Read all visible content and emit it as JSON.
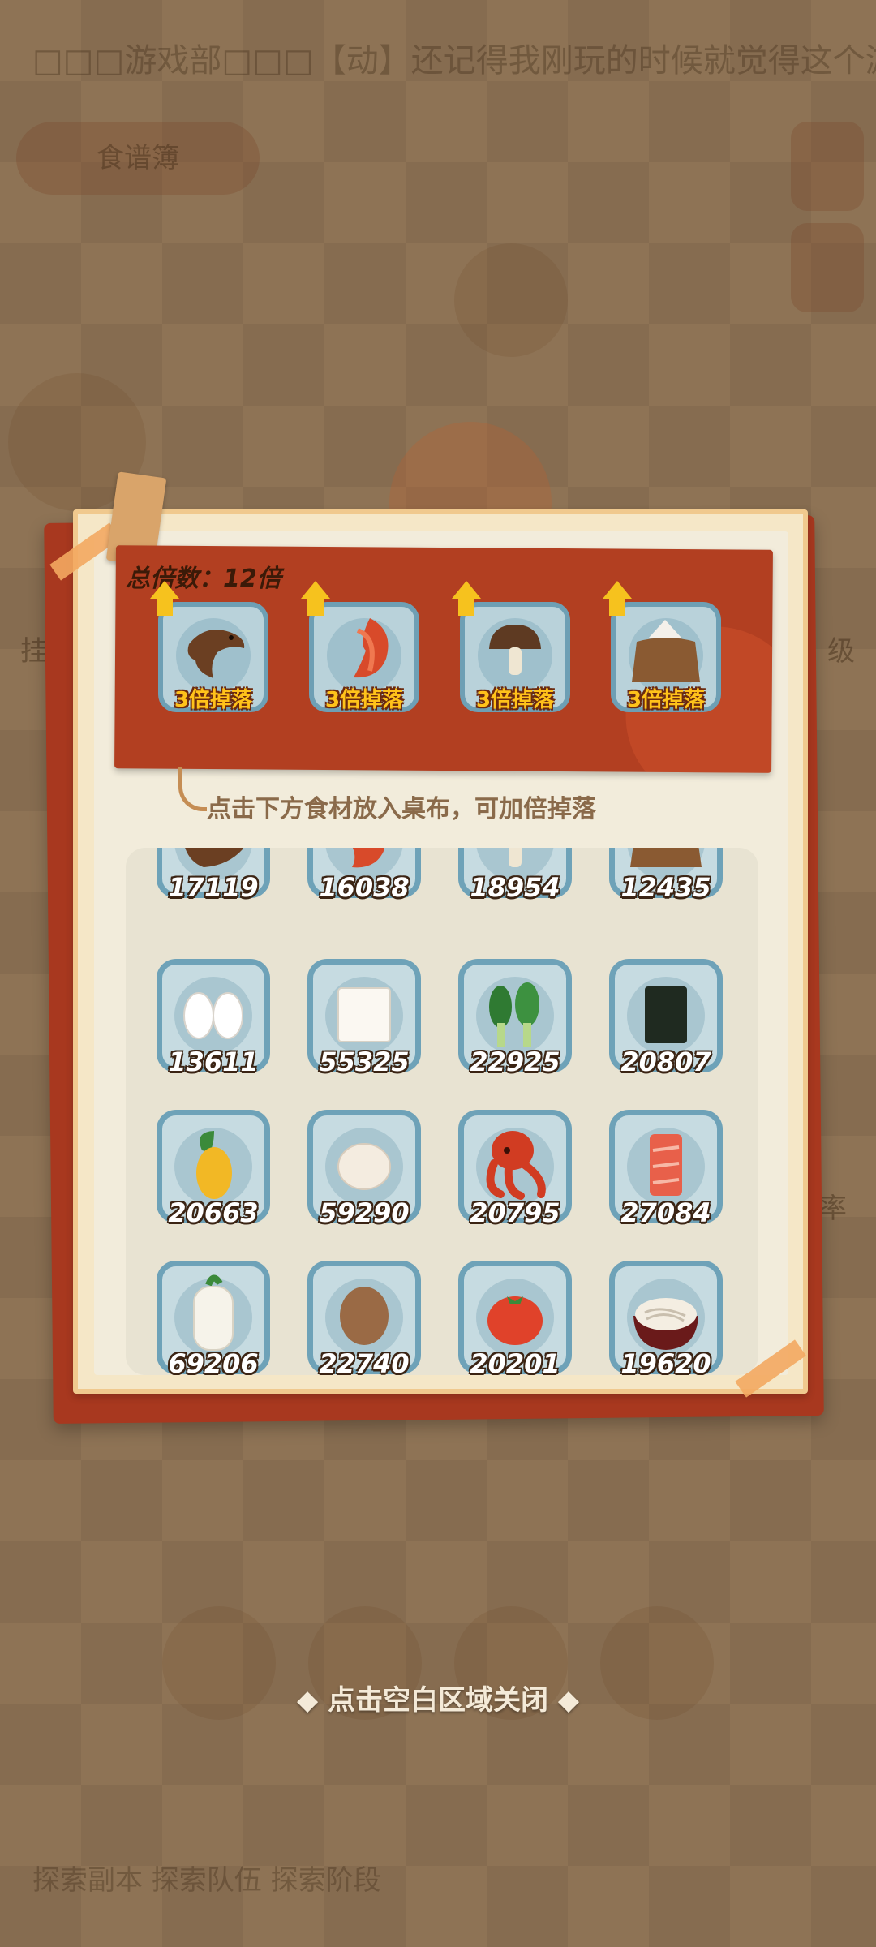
{
  "background": {
    "banner_text": "□□□游戏部□□□【动】还记得我刚玩的时候就觉得这个游戏",
    "pill_label": "食谱簿",
    "side_left": "挂",
    "side_right_top": "级",
    "side_right_mid": "率",
    "bottom_text": "探索副本    探索队伍    探索阶段"
  },
  "panel": {
    "title": "总倍数：12倍",
    "hint": "点击下方食材放入桌布，可加倍掉落",
    "selected": [
      {
        "icon": "catfish-icon",
        "label": "3倍掉落"
      },
      {
        "icon": "shrimp-icon",
        "label": "3倍掉落"
      },
      {
        "icon": "mushroom-icon",
        "label": "3倍掉落"
      },
      {
        "icon": "flour-sack-icon",
        "label": "3倍掉落"
      }
    ],
    "ingredients": [
      {
        "icon": "catfish-icon",
        "count": "17119"
      },
      {
        "icon": "shrimp-icon",
        "count": "16038"
      },
      {
        "icon": "mushroom-icon",
        "count": "18954"
      },
      {
        "icon": "flour-sack-icon",
        "count": "12435"
      },
      {
        "icon": "rice-ball-icon",
        "count": "13611"
      },
      {
        "icon": "tofu-icon",
        "count": "55325"
      },
      {
        "icon": "greens-icon",
        "count": "22925"
      },
      {
        "icon": "seaweed-icon",
        "count": "20807"
      },
      {
        "icon": "corn-icon",
        "count": "20663"
      },
      {
        "icon": "egg-icon",
        "count": "59290"
      },
      {
        "icon": "octopus-icon",
        "count": "20795"
      },
      {
        "icon": "salmon-icon",
        "count": "27084"
      },
      {
        "icon": "radish-icon",
        "count": "69206"
      },
      {
        "icon": "potato-icon",
        "count": "22740"
      },
      {
        "icon": "tomato-icon",
        "count": "20201"
      },
      {
        "icon": "noodle-bowl-icon",
        "count": "19620"
      }
    ]
  },
  "close_hint": "◆ 点击空白区域关闭 ◆",
  "colors": {
    "board_red": "#b23f21",
    "gold": "#ffc21a",
    "slot_blue": "#6ea2b8"
  }
}
